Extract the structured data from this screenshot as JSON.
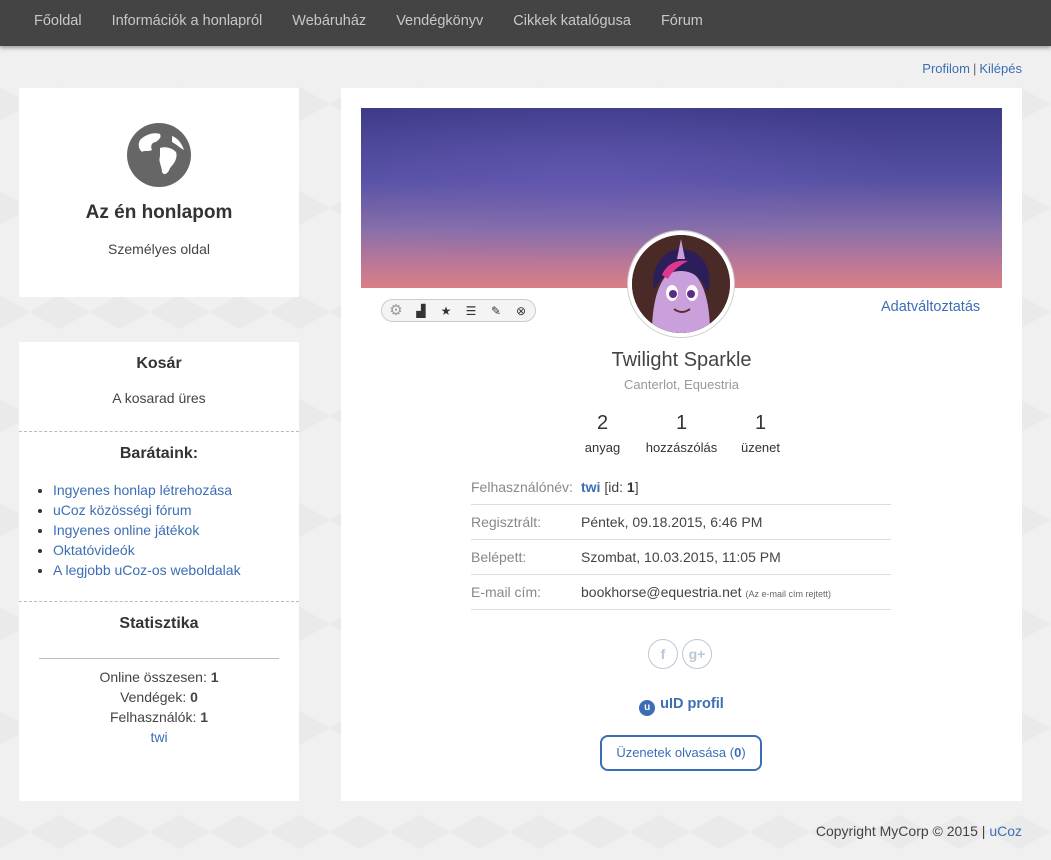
{
  "nav": {
    "items": [
      "Főoldal",
      "Információk a honlapról",
      "Webáruház",
      "Vendégkönyv",
      "Cikkek katalógusa",
      "Fórum"
    ]
  },
  "userlinks": {
    "profile": "Profilom",
    "separator": "|",
    "logout": "Kilépés"
  },
  "site": {
    "title": "Az én honlapom",
    "subtitle": "Személyes oldal",
    "icon": "globe-icon"
  },
  "cart": {
    "title": "Kosár",
    "text": "A kosarad üres"
  },
  "friends": {
    "title": "Barátaink:",
    "links": [
      "Ingyenes honlap létrehozása",
      "uCoz közösségi fórum",
      "Ingyenes online játékok",
      "Oktatóvideók",
      "A legjobb uCoz-os weboldalak"
    ]
  },
  "stats": {
    "title": "Statisztika",
    "online_label": "Online összesen:",
    "online_value": "1",
    "guests_label": "Vendégek:",
    "guests_value": "0",
    "users_label": "Felhasználók:",
    "users_value": "1",
    "user_link": "twi"
  },
  "profile": {
    "edit_link": "Adatváltoztatás",
    "toolbar_icons": [
      "gear-icon",
      "bar-chart-icon",
      "star-icon",
      "list-icon",
      "pencil-icon",
      "close-circle-icon"
    ],
    "name": "Twilight Sparkle",
    "location": "Canterlot, Equestria",
    "counters": [
      {
        "num": "2",
        "label": "anyag"
      },
      {
        "num": "1",
        "label": "hozzászólás"
      },
      {
        "num": "1",
        "label": "üzenet"
      }
    ],
    "info": {
      "username_label": "Felhasználónév:",
      "username": "twi",
      "id_prefix": "[id:",
      "id_value": "1",
      "id_suffix": "]",
      "registered_label": "Regisztrált:",
      "registered": "Péntek, 09.18.2015, 6:46 PM",
      "login_label": "Belépett:",
      "login": "Szombat, 10.03.2015, 11:05 PM",
      "email_label": "E-mail cím:",
      "email": "bookhorse@equestria.net",
      "email_note": "(Az e-mail cím rejtett)"
    },
    "social": {
      "facebook": "f",
      "googleplus": "g+"
    },
    "uid_label": "uID profil",
    "messages_label": "Üzenetek olvasása (",
    "messages_count": "0",
    "messages_suffix": ")"
  },
  "footer": {
    "copyright": "Copyright MyCorp © 2015",
    "separator": "|",
    "link": "uCoz"
  }
}
